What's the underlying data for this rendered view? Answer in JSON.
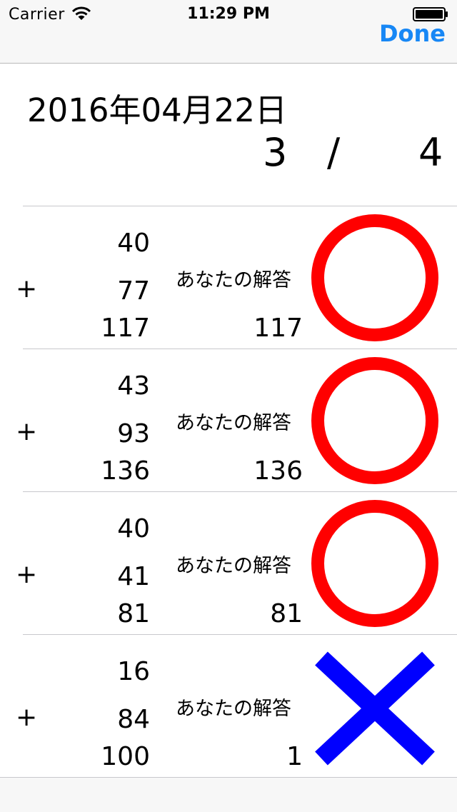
{
  "status_bar": {
    "carrier": "Carrier",
    "time": "11:29 PM",
    "wifi_icon": "wifi-icon",
    "battery_icon": "battery-icon"
  },
  "nav": {
    "done_label": "Done",
    "accent_color": "#1787f5"
  },
  "header": {
    "date": "2016年04月22日",
    "score_correct": "3",
    "score_separator": "/",
    "score_total": "4"
  },
  "answer_label": "あなたの解答",
  "operator": "+",
  "mark_colors": {
    "correct": "#ff0000",
    "wrong": "#0000ff"
  },
  "problems": [
    {
      "a": "40",
      "b": "77",
      "sum": "117",
      "answer_label": "あなたの解答",
      "answer": "117",
      "result": "correct"
    },
    {
      "a": "43",
      "b": "93",
      "sum": "136",
      "answer_label": "あなたの解答",
      "answer": "136",
      "result": "correct"
    },
    {
      "a": "40",
      "b": "41",
      "sum": "81",
      "answer_label": "あなたの解答",
      "answer": "81",
      "result": "correct"
    },
    {
      "a": "16",
      "b": "84",
      "sum": "100",
      "answer_label": "あなたの解答",
      "answer": "1",
      "result": "wrong"
    }
  ]
}
